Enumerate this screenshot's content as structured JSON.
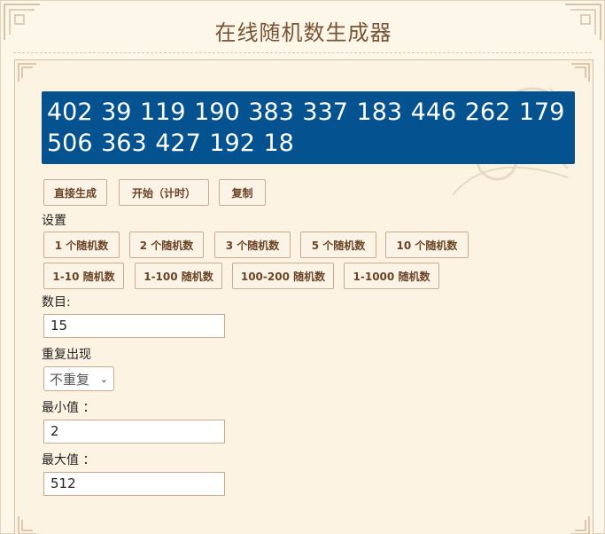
{
  "page": {
    "title": "在线随机数生成器"
  },
  "result": {
    "text": "402 39 119 190 383 337 183 446 262 179 506 363 427 192 18"
  },
  "actions": {
    "direct": "直接生成",
    "start": "开始（计时）",
    "copy": "复制"
  },
  "settings": {
    "heading": "设置",
    "presets_row1": [
      "1 个随机数",
      "2 个随机数",
      "3 个随机数",
      "5 个随机数",
      "10 个随机数"
    ],
    "presets_row2": [
      "1-10 随机数",
      "1-100 随机数",
      "100-200 随机数",
      "1-1000 随机数"
    ],
    "count_label": "数目:",
    "count_value": "15",
    "repeat_label": "重复出现",
    "repeat_value": "不重复",
    "min_label": "最小值  ：",
    "min_value": "2",
    "max_label": "最大值  ：",
    "max_value": "512"
  },
  "colors": {
    "result_bg": "#04528f",
    "accent": "#7a5434",
    "page_bg": "#fdf7ea"
  }
}
